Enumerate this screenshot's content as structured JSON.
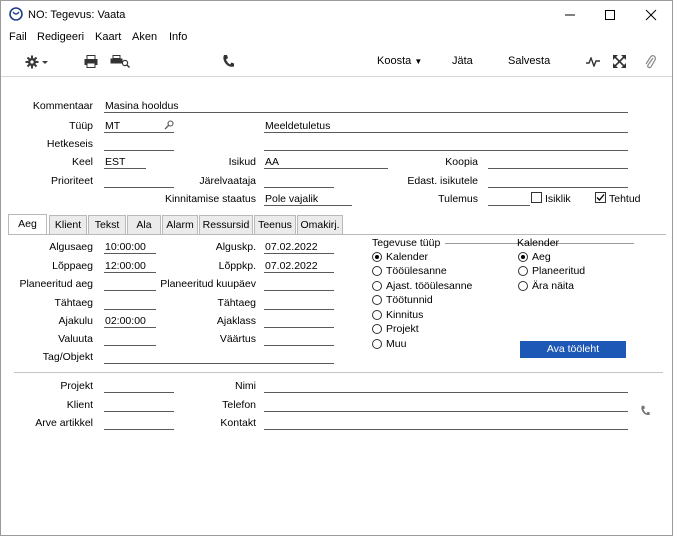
{
  "window": {
    "title": "NO: Tegevus: Vaata"
  },
  "menu": {
    "items": [
      "Fail",
      "Redigeeri",
      "Kaart",
      "Aken",
      "Info"
    ]
  },
  "toolbar": {
    "koosta": "Koosta",
    "jata": "Jäta",
    "salvesta": "Salvesta"
  },
  "header": {
    "kommentaar_label": "Kommentaar",
    "kommentaar_value": "Masina hooldus",
    "tuup_label": "Tüüp",
    "tuup_value": "MT",
    "tuup_desc": "Meeldetuletus",
    "hetkeseis_label": "Hetkeseis",
    "keel_label": "Keel",
    "keel_value": "EST",
    "isikud_label": "Isikud",
    "isikud_value": "AA",
    "koopia_label": "Koopia",
    "prioriteet_label": "Prioriteet",
    "jarelvaataja_label": "Järelvaataja",
    "edast_label": "Edast. isikutele",
    "kinnitamise_label": "Kinnitamise staatus",
    "kinnitamise_value": "Pole vajalik",
    "tulemus_label": "Tulemus",
    "isiklik_label": "Isiklik",
    "isiklik_checked": false,
    "tehtud_label": "Tehtud",
    "tehtud_checked": true
  },
  "tabs": [
    "Aeg",
    "Klient",
    "Tekst",
    "Ala",
    "Alarm",
    "Ressursid",
    "Teenus",
    "Omakirj."
  ],
  "aeg": {
    "algusaeg_label": "Algusaeg",
    "algusaeg_value": "10:00:00",
    "loppaeg_label": "Lõppaeg",
    "loppaeg_value": "12:00:00",
    "plan_aeg_label": "Planeeritud aeg",
    "tahtaeg_label": "Tähtaeg",
    "ajakulu_label": "Ajakulu",
    "ajakulu_value": "02:00:00",
    "valuuta_label": "Valuuta",
    "tag_label": "Tag/Objekt",
    "alguskp_label": "Alguskp.",
    "alguskp_value": "07.02.2022",
    "loppkp_label": "Lõppkp.",
    "loppkp_value": "07.02.2022",
    "plan_kp_label": "Planeeritud kuupäev",
    "tahtaeg2_label": "Tähtaeg",
    "ajaklass_label": "Ajaklass",
    "vaartus_label": "Väärtus"
  },
  "tegevuse_tuup": {
    "title": "Tegevuse tüüp",
    "options": [
      "Kalender",
      "Tööülesanne",
      "Ajast. tööülesanne",
      "Töötunnid",
      "Kinnitus",
      "Projekt",
      "Muu"
    ],
    "selected": "Kalender"
  },
  "kalender": {
    "title": "Kalender",
    "options": [
      "Aeg",
      "Planeeritud",
      "Ära näita"
    ],
    "selected": "Aeg",
    "button": "Ava tööleht"
  },
  "footer": {
    "projekt_label": "Projekt",
    "klient_label": "Klient",
    "arve_label": "Arve artikkel",
    "nimi_label": "Nimi",
    "telefon_label": "Telefon",
    "kontakt_label": "Kontakt"
  },
  "colors": {
    "accent": "#1e58b6"
  }
}
